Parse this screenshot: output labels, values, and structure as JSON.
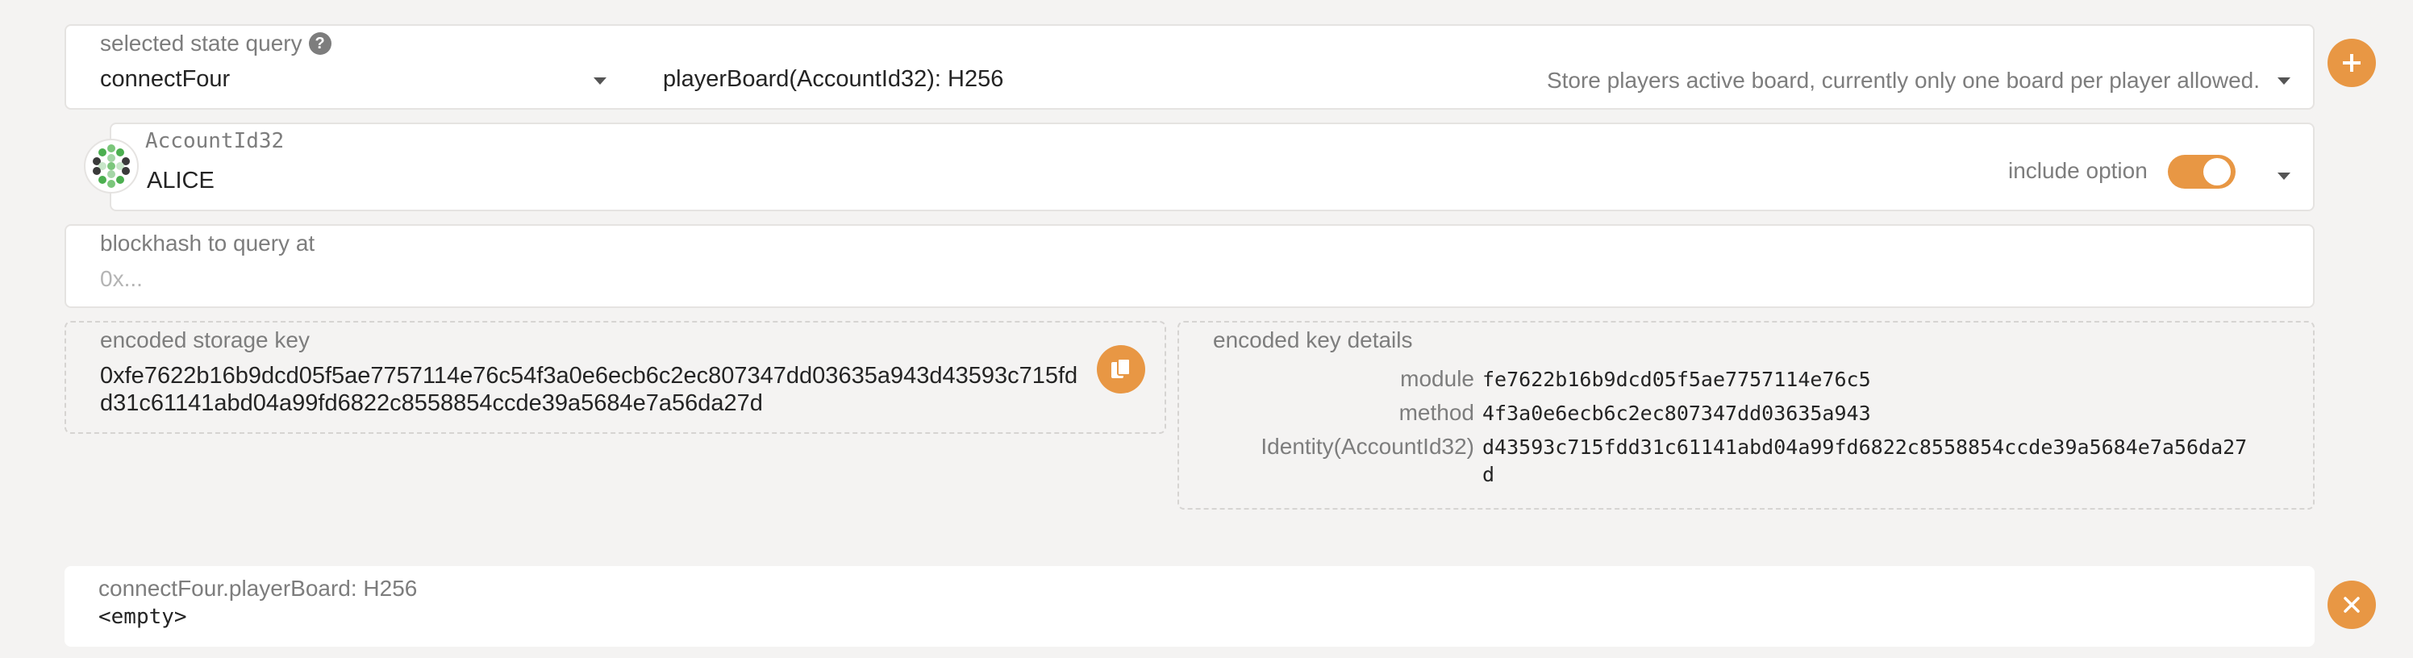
{
  "query": {
    "label": "selected state query",
    "help_icon": "?",
    "module": "connectFour",
    "method_signature": "playerBoard(AccountId32): H256",
    "description": "Store players active board, currently only one board per player allowed."
  },
  "account": {
    "label": "AccountId32",
    "value": "ALICE",
    "include_option_label": "include option",
    "include_option": true
  },
  "blockhash": {
    "label": "blockhash to query at",
    "placeholder": "0x..."
  },
  "encoded_key": {
    "label": "encoded storage key",
    "line1": "0xfe7622b16b9dcd05f5ae7757114e76c54f3a0e6ecb6c2ec807347dd03635a943d43593c715fd",
    "line2": "d31c61141abd04a99fd6822c8558854ccde39a5684e7a56da27d"
  },
  "key_details": {
    "label": "encoded key details",
    "rows": [
      {
        "name": "module",
        "value": "fe7622b16b9dcd05f5ae7757114e76c5"
      },
      {
        "name": "method",
        "value": "4f3a0e6ecb6c2ec807347dd03635a943"
      },
      {
        "name": "Identity(AccountId32)",
        "value": "d43593c715fdd31c61141abd04a99fd6822c8558854ccde39a5684e7a56da27",
        "value2": "d"
      }
    ]
  },
  "result": {
    "label": "connectFour.playerBoard: H256",
    "value": "<empty>"
  },
  "colors": {
    "accent": "#e89744",
    "background": "#f4f3f2"
  },
  "icons": {
    "add": "plus-icon",
    "remove": "close-icon",
    "copy": "copy-icon",
    "identicon": "identicon-icon"
  }
}
